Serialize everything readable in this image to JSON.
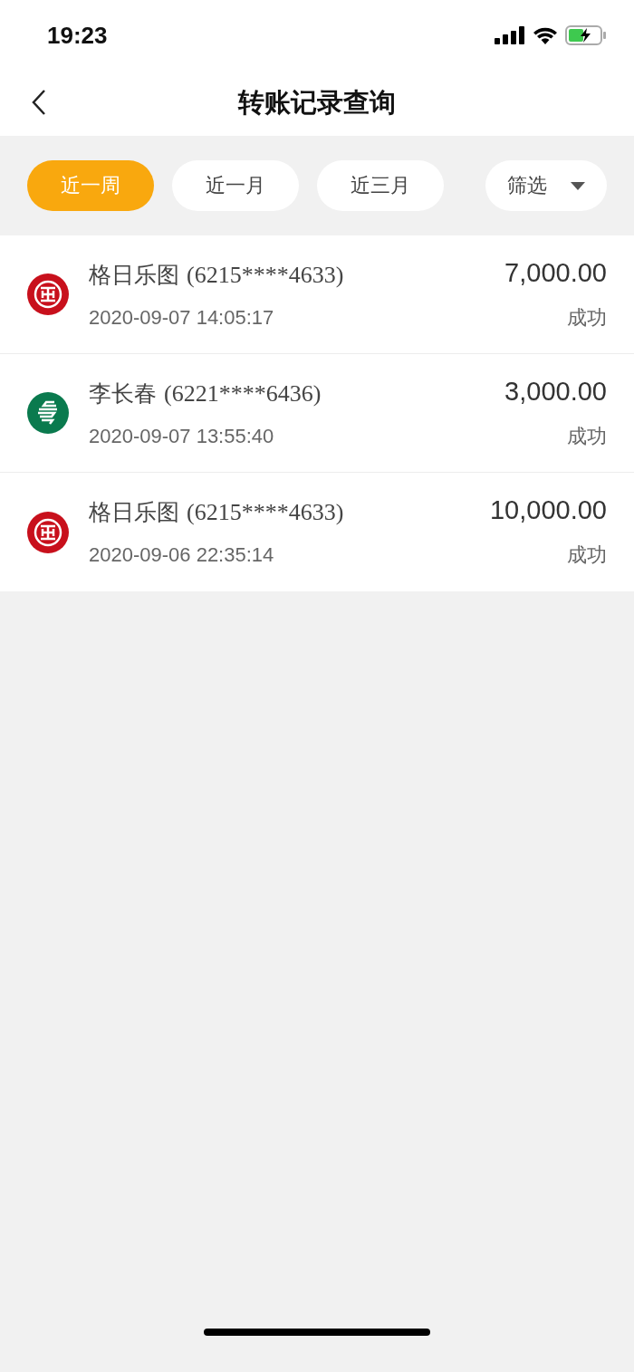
{
  "status_bar": {
    "time": "19:23"
  },
  "nav": {
    "title": "转账记录查询"
  },
  "filters": [
    {
      "label": "近一周",
      "selected": true
    },
    {
      "label": "近一月",
      "selected": false
    },
    {
      "label": "近三月",
      "selected": false
    }
  ],
  "filter_menu": {
    "label": "筛选"
  },
  "records": [
    {
      "kind": "ring",
      "color": "#c8101c",
      "name": "格日乐图",
      "account": "(6215****4633)",
      "time": "2020-09-07 14:05:17",
      "amount": "7,000.00",
      "status": "成功"
    },
    {
      "kind": "stripes",
      "color": "#0a7a4e",
      "name": "李长春",
      "account": "(6221****6436)",
      "time": "2020-09-07 13:55:40",
      "amount": "3,000.00",
      "status": "成功"
    },
    {
      "kind": "ring",
      "color": "#c8101c",
      "name": "格日乐图",
      "account": "(6215****4633)",
      "time": "2020-09-06 22:35:14",
      "amount": "10,000.00",
      "status": "成功"
    }
  ]
}
